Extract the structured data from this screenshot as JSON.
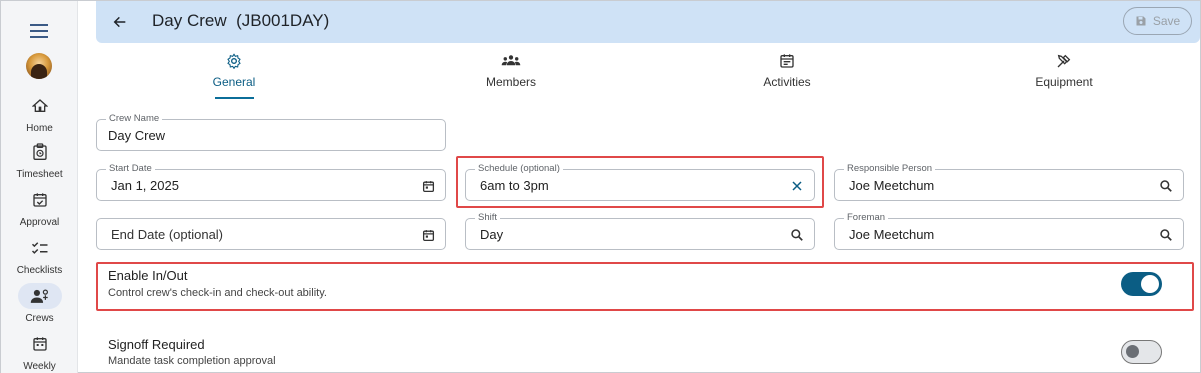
{
  "header": {
    "title": "Day Crew  (JB001DAY)",
    "save_label": "Save"
  },
  "sidebar": {
    "items": [
      {
        "label": "Home",
        "icon": "home-icon"
      },
      {
        "label": "Timesheet",
        "icon": "timesheet-icon"
      },
      {
        "label": "Approval",
        "icon": "approval-icon"
      },
      {
        "label": "Checklists",
        "icon": "checklist-icon"
      },
      {
        "label": "Crews",
        "icon": "crews-icon",
        "active": true
      },
      {
        "label": "Weekly",
        "icon": "calendar-icon"
      }
    ]
  },
  "tabs": [
    {
      "label": "General",
      "icon": "gear-icon",
      "active": true
    },
    {
      "label": "Members",
      "icon": "group-icon"
    },
    {
      "label": "Activities",
      "icon": "event-note-icon"
    },
    {
      "label": "Equipment",
      "icon": "tools-icon"
    }
  ],
  "form": {
    "crew_name": {
      "label": "Crew Name",
      "value": "Day Crew"
    },
    "start_date": {
      "label": "Start Date",
      "value": "Jan 1, 2025"
    },
    "schedule": {
      "label": "Schedule (optional)",
      "value": "6am to 3pm"
    },
    "responsible_person": {
      "label": "Responsible Person",
      "value": "Joe Meetchum"
    },
    "end_date": {
      "placeholder": "End Date (optional)"
    },
    "shift": {
      "label": "Shift",
      "value": "Day"
    },
    "foreman": {
      "label": "Foreman",
      "value": "Joe Meetchum"
    }
  },
  "toggles": {
    "inout": {
      "title": "Enable In/Out",
      "description": "Control crew's check-in and check-out ability.",
      "on": true
    },
    "signoff": {
      "title": "Signoff Required",
      "description": "Mandate task completion approval",
      "on": false
    }
  },
  "colors": {
    "accent": "#0b5d84",
    "topbar": "#cfe2f6",
    "highlight": "#e04848"
  }
}
